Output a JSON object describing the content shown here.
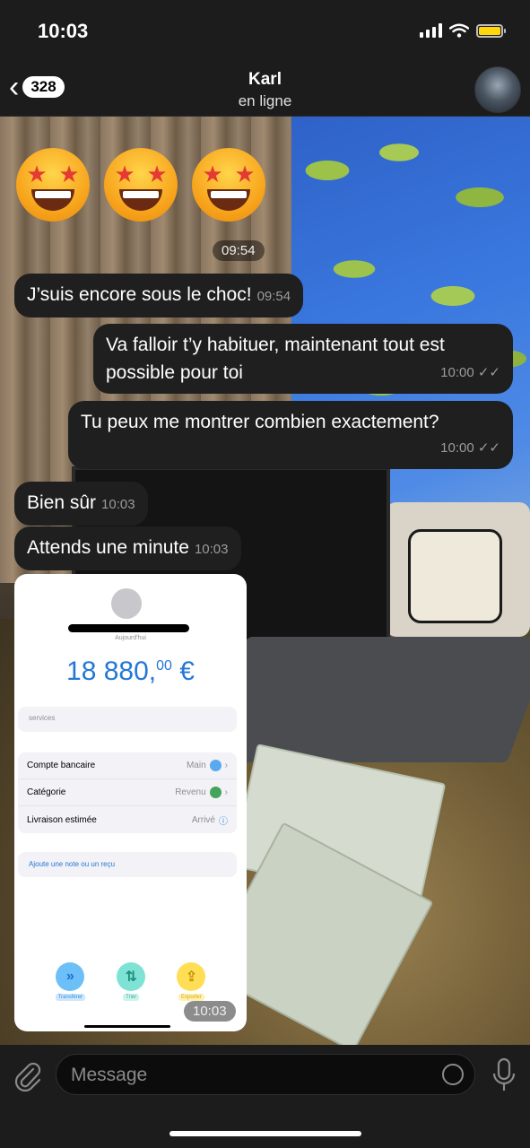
{
  "status": {
    "time": "10:03"
  },
  "header": {
    "back_count": "328",
    "title": "Karl",
    "subtitle": "en ligne"
  },
  "messages": {
    "emoji_time": "09:54",
    "m1": {
      "text": "J’suis encore sous le choc!",
      "time": "09:54"
    },
    "m2": {
      "text": "Va falloir t’y habituer, maintenant tout est possible pour toi",
      "time": "10:00"
    },
    "m3": {
      "text": "Tu peux me montrer combien exactement?",
      "time": "10:00"
    },
    "m4": {
      "text": "Bien sûr",
      "time": "10:03"
    },
    "m5": {
      "text": "Attends une minute",
      "time": "10:03"
    },
    "image_time": "10:03"
  },
  "screenshot": {
    "date": "Aujourd'hui",
    "amount_main": "18 880,",
    "amount_cents": "00",
    "currency": "€",
    "services": "services",
    "rows": [
      {
        "label": "Compte bancaire",
        "value": "Main"
      },
      {
        "label": "Catégorie",
        "value": "Revenu"
      },
      {
        "label": "Livraison estimée",
        "value": "Arrivé"
      }
    ],
    "note_link": "Ajoute une note ou un reçu",
    "buttons": [
      {
        "label": "Transférer",
        "color": "#2f8fe8"
      },
      {
        "label": "Trier",
        "color": "#32b6a7"
      },
      {
        "label": "Exporter",
        "color": "#f2c230"
      }
    ]
  },
  "input": {
    "placeholder": "Message"
  },
  "colors": {
    "accent": "#2478d6",
    "bubble": "#1f1f1f",
    "battery": "#ffd60a"
  }
}
